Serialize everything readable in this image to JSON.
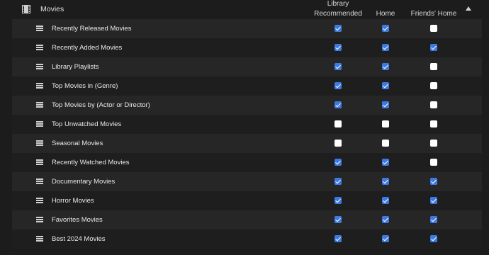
{
  "header": {
    "section_title": "Movies",
    "icon": "film-icon",
    "sort_icon": "caret-up-icon",
    "col_library": "Library\nRecommended",
    "col_library_line1": "Library",
    "col_library_line2": "Recommended",
    "col_home": "Home",
    "col_friends": "Friends' Home"
  },
  "colors": {
    "accent": "#3d7ae0",
    "background": "#1c1c1c",
    "row_alt": "#262626"
  },
  "rows": [
    {
      "label": "Recently Released Movies",
      "library": true,
      "home": true,
      "friends": false
    },
    {
      "label": "Recently Added Movies",
      "library": true,
      "home": true,
      "friends": true
    },
    {
      "label": "Library Playlists",
      "library": true,
      "home": true,
      "friends": false
    },
    {
      "label": "Top Movies in (Genre)",
      "library": true,
      "home": true,
      "friends": false
    },
    {
      "label": "Top Movies by (Actor or Director)",
      "library": true,
      "home": true,
      "friends": false
    },
    {
      "label": "Top Unwatched Movies",
      "library": false,
      "home": false,
      "friends": false
    },
    {
      "label": "Seasonal Movies",
      "library": false,
      "home": false,
      "friends": false
    },
    {
      "label": "Recently Watched Movies",
      "library": true,
      "home": true,
      "friends": false
    },
    {
      "label": "Documentary Movies",
      "library": true,
      "home": true,
      "friends": true
    },
    {
      "label": "Horror Movies",
      "library": true,
      "home": true,
      "friends": true
    },
    {
      "label": "Favorites Movies",
      "library": true,
      "home": true,
      "friends": true
    },
    {
      "label": "Best 2024 Movies",
      "library": true,
      "home": true,
      "friends": true
    }
  ]
}
